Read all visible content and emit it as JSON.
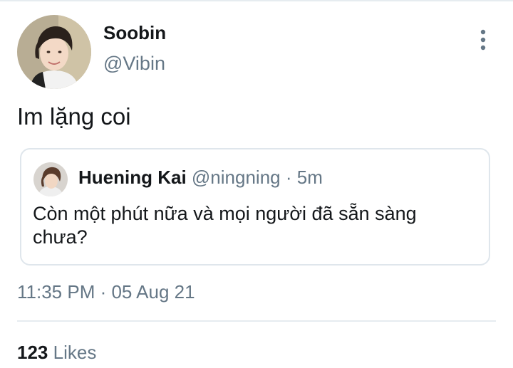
{
  "tweet": {
    "author": {
      "display_name": "Soobin",
      "handle": "@Vibin",
      "avatar_icon": "user-avatar-photo"
    },
    "text": "Im lặng coi",
    "more_icon": "more-vertical-icon",
    "timestamp": "11:35 PM · 05 Aug 21",
    "likes": {
      "count": "123",
      "label": "Likes"
    }
  },
  "quoted_tweet": {
    "author": {
      "display_name": "Huening Kai",
      "handle": "@ningning",
      "avatar_icon": "user-avatar-photo"
    },
    "meta_separator": " · ",
    "time_ago": "5m",
    "text": "Còn một phút nữa và mọi người đã sẵn sàng chưa?"
  },
  "colors": {
    "primary_text": "#14171a",
    "secondary_text": "#657786",
    "divider": "#e6ecf0",
    "card_border": "#dfe6ec"
  }
}
